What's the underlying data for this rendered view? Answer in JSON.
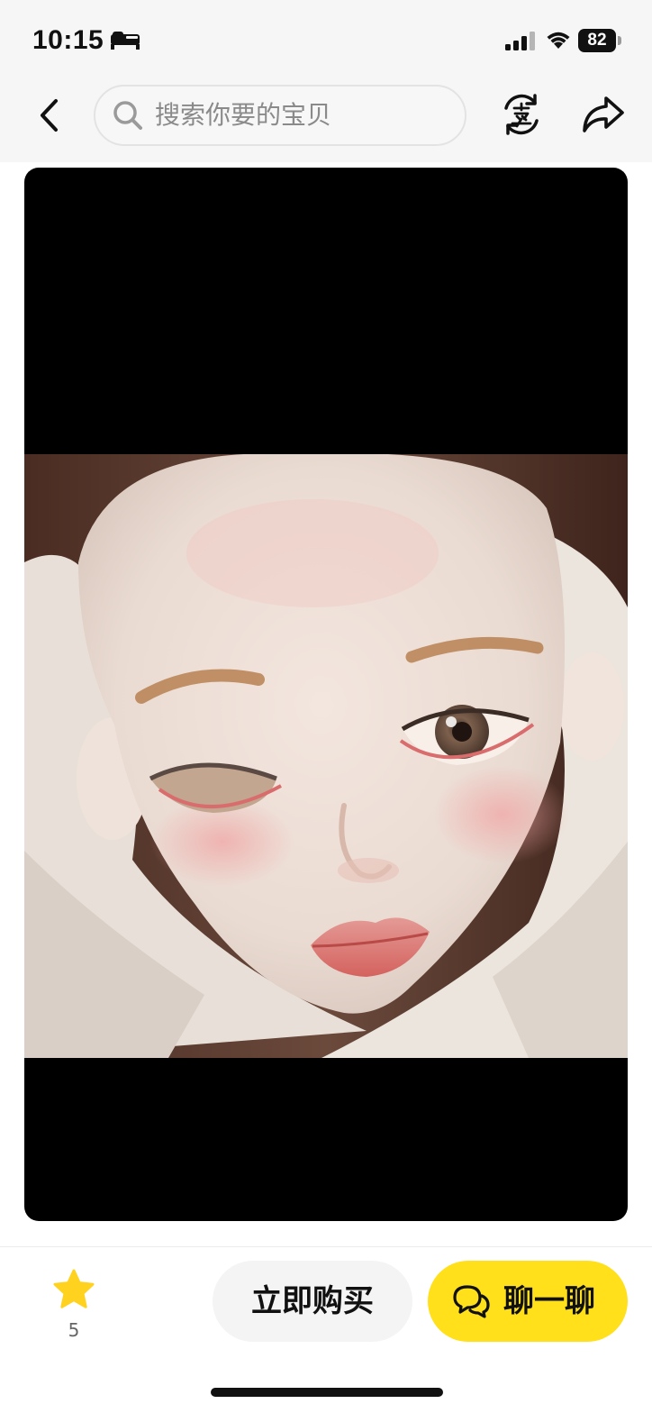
{
  "status_bar": {
    "time": "10:15",
    "battery": "82",
    "icons": [
      "sleep-focus-icon",
      "cellular-signal-icon",
      "wifi-icon",
      "battery-icon"
    ]
  },
  "nav": {
    "back_icon": "chevron-left-icon",
    "search_placeholder": "搜索你要的宝贝",
    "sell_icon": "sell-exchange-icon",
    "share_icon": "share-icon"
  },
  "media": {
    "content": "doll-head-photo"
  },
  "bottom_bar": {
    "favorite_icon": "star-icon",
    "favorite_count": "5",
    "buy_now_label": "立即购买",
    "chat_label": "聊一聊",
    "chat_icon": "chat-bubbles-icon"
  },
  "colors": {
    "accent_yellow": "#ffe01a",
    "star_yellow": "#ffd21f",
    "top_bar_bg": "#f6f6f6"
  }
}
